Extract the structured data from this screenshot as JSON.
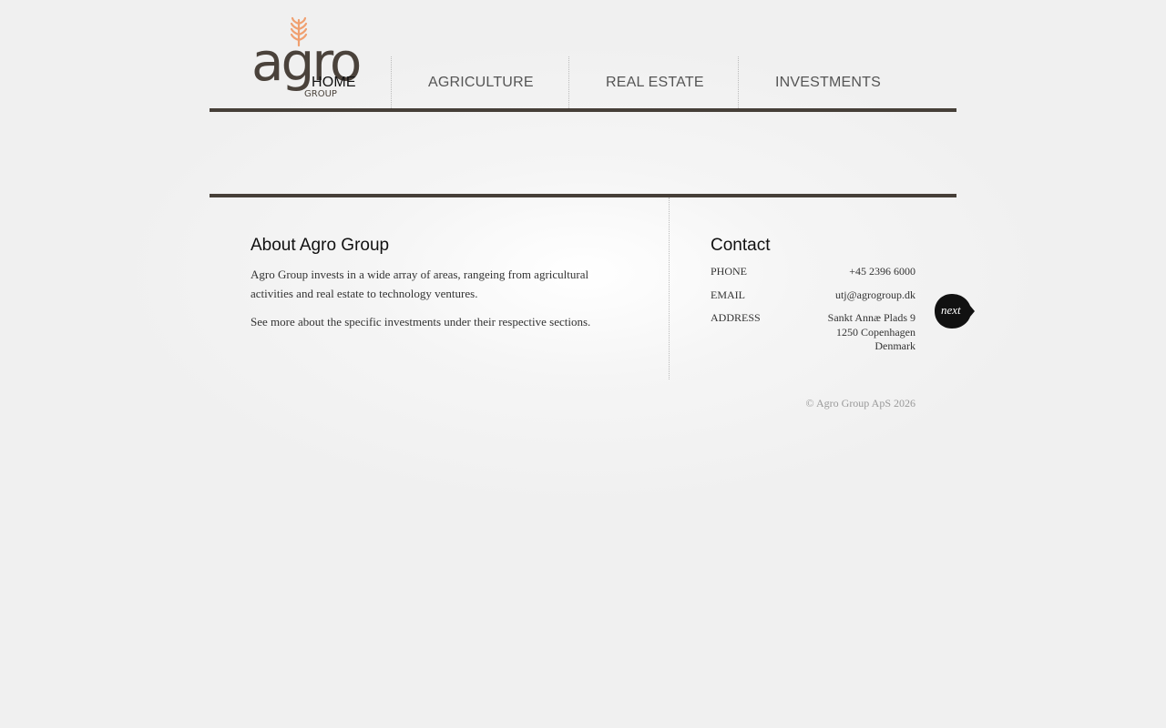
{
  "logo": {
    "word": "agro",
    "sub": "GROUP"
  },
  "nav": [
    {
      "label": "HOME"
    },
    {
      "label": "AGRICULTURE"
    },
    {
      "label": "REAL ESTATE"
    },
    {
      "label": "INVESTMENTS"
    }
  ],
  "about": {
    "title": "About Agro Group",
    "p1": "Agro Group invests in a wide array of areas, rangeing from agricultural activities and real estate to technology ventures.",
    "p2": "See more about the specific investments under their respective sections."
  },
  "contact": {
    "title": "Contact",
    "phone_label": "PHONE",
    "phone_value": "+45 2396 6000",
    "email_label": "EMAIL",
    "email_value": "utj@agrogroup.dk",
    "address_label": "ADDRESS",
    "address_line1": "Sankt Annæ Plads 9",
    "address_line2": "1250 Copenhagen",
    "address_line3": "Denmark"
  },
  "next_label": "next",
  "footer": "© Agro Group ApS 2026",
  "colors": {
    "dark_brown": "#463f38",
    "leaf_orange": "#f0a070"
  }
}
